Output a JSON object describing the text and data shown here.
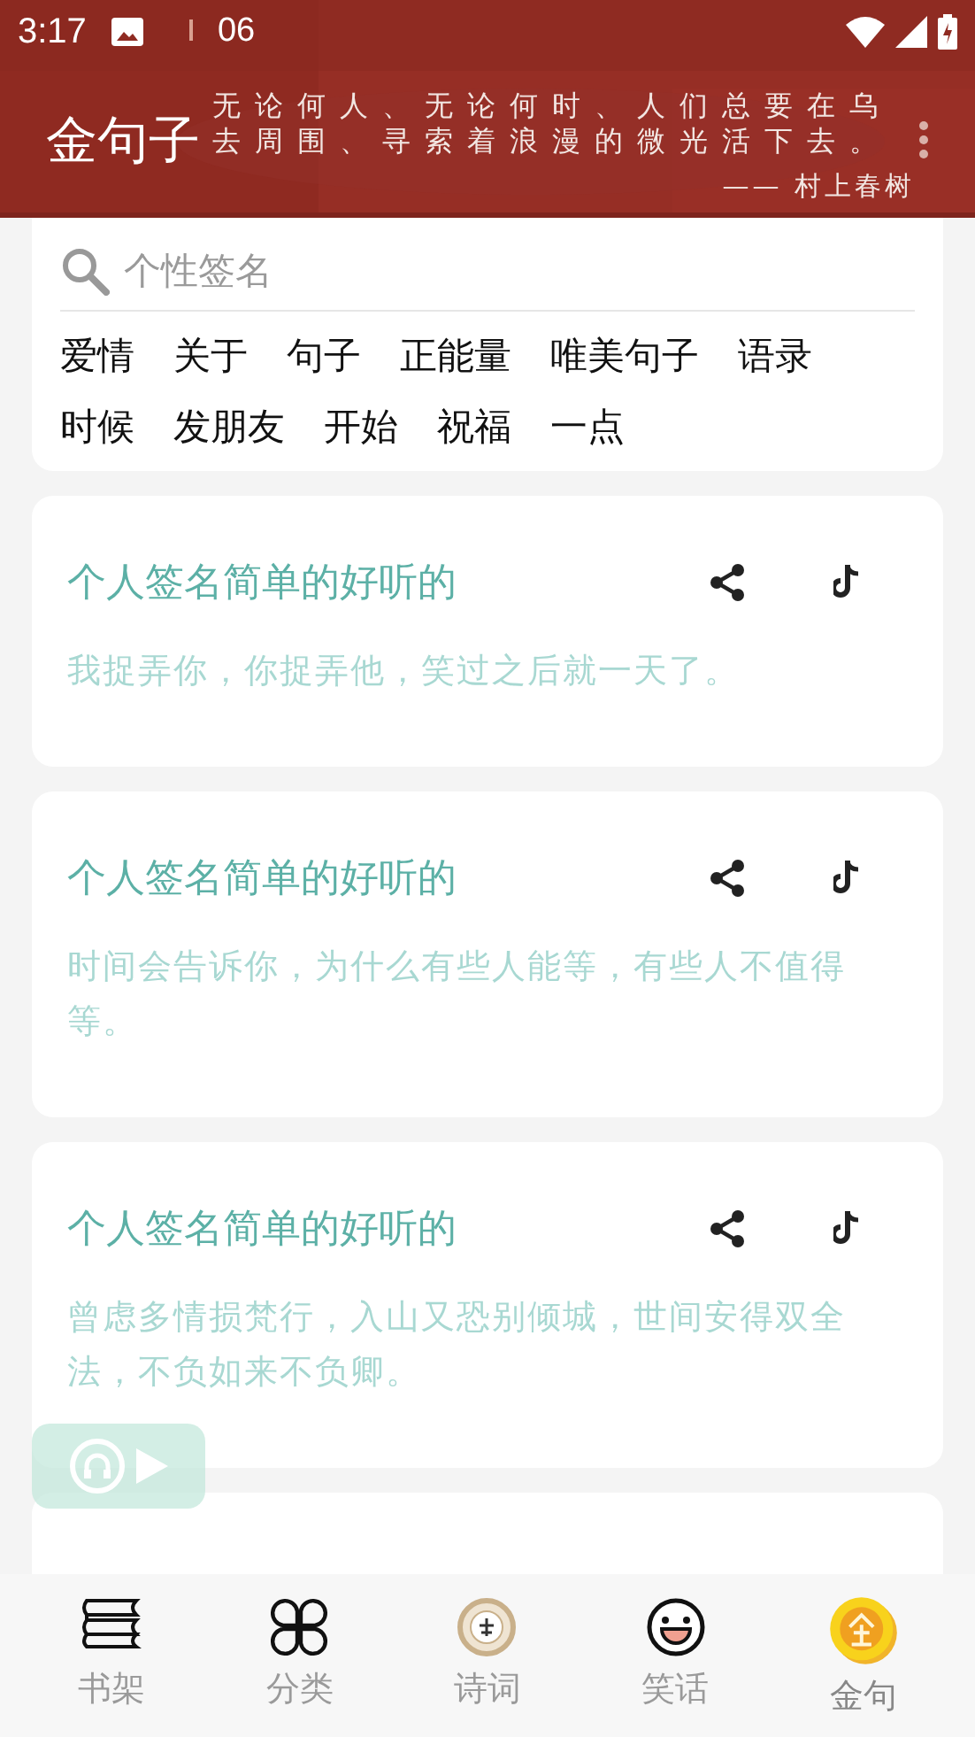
{
  "status_bar": {
    "time": "3:17",
    "extra": "06"
  },
  "header": {
    "title": "金句子",
    "quote_lines": [
      "无论何人、无论何时、人们总要在乌",
      "去周围、寻索着浪漫的微光活下去。"
    ],
    "author": "—— 村上春树"
  },
  "search": {
    "placeholder": "个性签名"
  },
  "tags": [
    [
      "爱情",
      "关于",
      "句子",
      "正能量",
      "唯美句子",
      "语录"
    ],
    [
      "时候",
      "发朋友",
      "开始",
      "祝福",
      "一点"
    ]
  ],
  "cards": [
    {
      "title": "个人签名简单的好听的",
      "text": "我捉弄你，你捉弄他，笑过之后就一天了。"
    },
    {
      "title": "个人签名简单的好听的",
      "text": "时间会告诉你，为什么有些人能等，有些人不值得等。"
    },
    {
      "title": "个人签名简单的好听的",
      "text": "曾虑多情损梵行，入山又恐别倾城，世间安得双全法，不负如来不负卿。"
    }
  ],
  "bottom_nav": [
    {
      "label": "书架",
      "kind": "shelf",
      "selected": false
    },
    {
      "label": "分类",
      "kind": "grid",
      "selected": false
    },
    {
      "label": "诗词",
      "kind": "poem",
      "selected": false
    },
    {
      "label": "笑话",
      "kind": "joke",
      "selected": false
    },
    {
      "label": "金句",
      "kind": "coin",
      "selected": true
    }
  ]
}
